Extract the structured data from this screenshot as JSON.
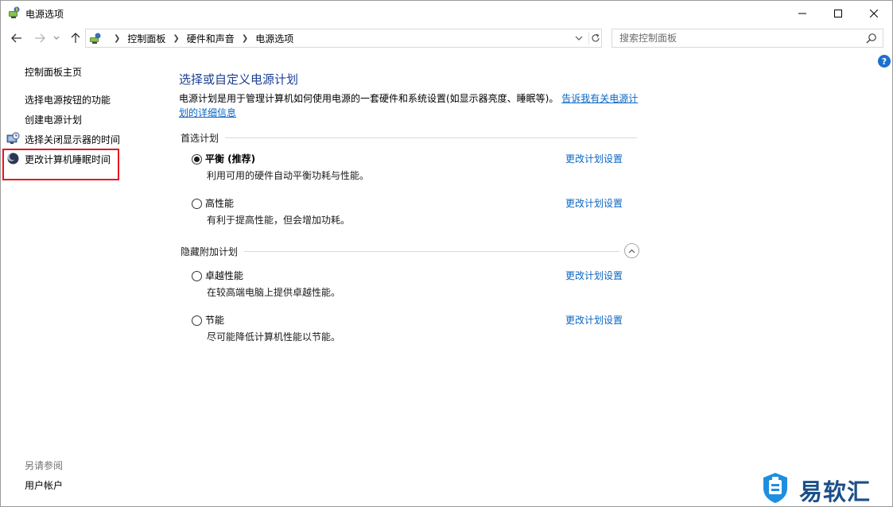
{
  "window": {
    "title": "电源选项"
  },
  "address": {
    "crumbs": [
      "控制面板",
      "硬件和声音",
      "电源选项"
    ],
    "search_placeholder": "搜索控制面板"
  },
  "left": {
    "home": "控制面板主页",
    "links": [
      "选择电源按钮的功能",
      "创建电源计划",
      "选择关闭显示器的时间",
      "更改计算机睡眠时间"
    ],
    "see_also": "另请参阅",
    "user_accounts": "用户帐户"
  },
  "main": {
    "title": "选择或自定义电源计划",
    "desc_text": "电源计划是用于管理计算机如何使用电源的一套硬件和系统设置(如显示器亮度、睡眠等)。",
    "desc_link": "告诉我有关电源计划的详细信息",
    "preferred_label": "首选计划",
    "hidden_label": "隐藏附加计划",
    "change_link": "更改计划设置",
    "plans": [
      {
        "name": "平衡 (推荐)",
        "desc": "利用可用的硬件自动平衡功耗与性能。",
        "selected": true
      },
      {
        "name": "高性能",
        "desc": "有利于提高性能，但会增加功耗。",
        "selected": false
      },
      {
        "name": "卓越性能",
        "desc": "在较高端电脑上提供卓越性能。",
        "selected": false
      },
      {
        "name": "节能",
        "desc": "尽可能降低计算机性能以节能。",
        "selected": false
      }
    ]
  },
  "watermark": {
    "text": "易软汇"
  },
  "colors": {
    "accent": "#1c3f94",
    "link": "#0b66c3",
    "highlight": "#e8141c"
  }
}
